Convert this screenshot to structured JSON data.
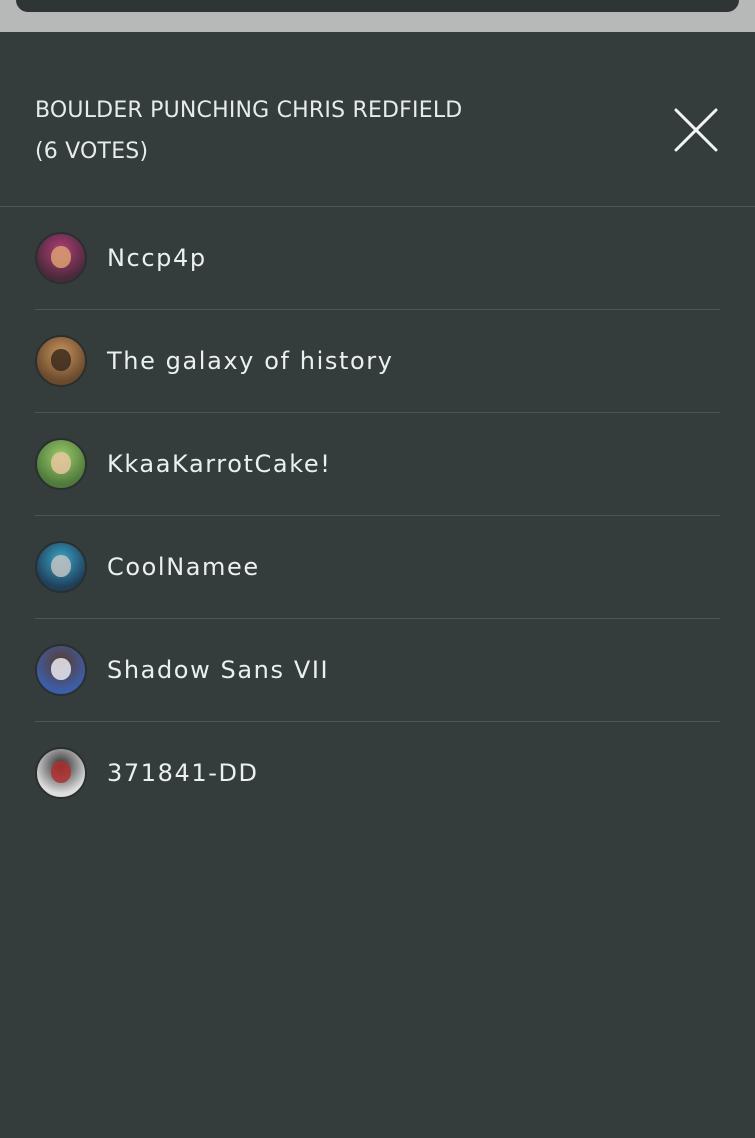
{
  "modal": {
    "title_line1": "BOULDER PUNCHING CHRIS REDFIELD",
    "title_line2": "(6 VOTES)",
    "close_icon": "close-icon"
  },
  "voters": [
    {
      "name": "Nccp4p",
      "avatar_colors": [
        "#4a2a3a",
        "#b33d78",
        "#d9a070"
      ]
    },
    {
      "name": "The galaxy of history",
      "avatar_colors": [
        "#6a4a2c",
        "#c9935e",
        "#3a2a1c"
      ]
    },
    {
      "name": "KkaaKarrotCake!",
      "avatar_colors": [
        "#4f7a3c",
        "#9ccc6a",
        "#e6c5a0"
      ]
    },
    {
      "name": "CoolNamee",
      "avatar_colors": [
        "#1f3f5a",
        "#3aa6c8",
        "#c2c2c2"
      ]
    },
    {
      "name": "Shadow Sans VII",
      "avatar_colors": [
        "#3c5ea8",
        "#5b3a2a",
        "#e9e9f2"
      ]
    },
    {
      "name": "371841-DD",
      "avatar_colors": [
        "#dedede",
        "#2a2a2a",
        "#b03030"
      ]
    }
  ]
}
